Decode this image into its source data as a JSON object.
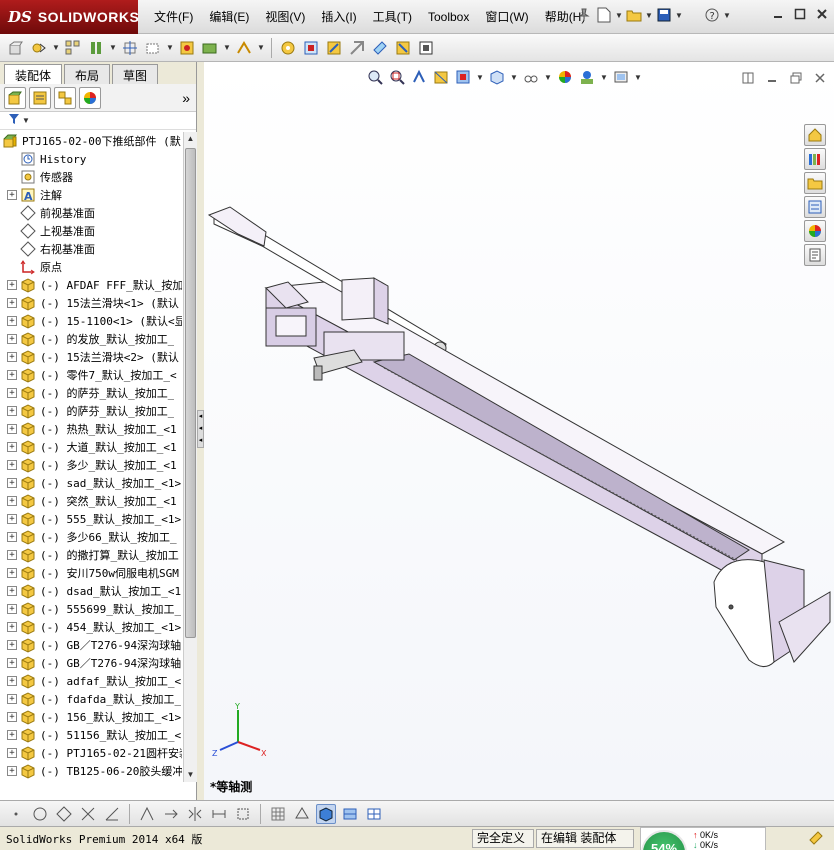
{
  "app": {
    "brand_ds": "DS",
    "brand_name": "SOLIDWORKS"
  },
  "menu": [
    "文件(F)",
    "编辑(E)",
    "视图(V)",
    "插入(I)",
    "工具(T)",
    "Toolbox",
    "窗口(W)",
    "帮助(H)"
  ],
  "title_tools": [
    "pushpin-icon",
    "new-document-icon",
    "open-folder-icon",
    "save-icon",
    "print-icon",
    "help-icon"
  ],
  "window_controls": [
    "minimize",
    "restore",
    "close"
  ],
  "toolbar_icons": [
    "insert-components-icon",
    "mate-icon",
    "linear-pattern-icon",
    "smart-fasteners-icon",
    "move-component-icon",
    "show-hidden-icon",
    "assembly-features-icon",
    "reference-geometry-icon",
    "new-motion-study-icon",
    "bill-of-materials-icon",
    "exploded-view-icon",
    "explode-line-sketch-icon",
    "interference-detection-icon",
    "clearance-verification-icon",
    "hole-alignment-icon",
    "measure-icon",
    "instant3d-icon"
  ],
  "left_panel": {
    "tabs": [
      "装配体",
      "布局",
      "草图"
    ],
    "active_tab": "装配体",
    "manager_icons": [
      "feature-manager-icon",
      "property-manager-icon",
      "configuration-manager-icon",
      "display-manager-icon"
    ],
    "more": "»",
    "filter_icon": "filter-icon",
    "tree": [
      {
        "label": "PTJ165-02-00下推纸部件  (默",
        "icon": "assembly",
        "expand": "",
        "level": 0
      },
      {
        "label": "History",
        "icon": "history",
        "expand": "",
        "level": 1
      },
      {
        "label": "传感器",
        "icon": "sensor",
        "expand": "",
        "level": 1
      },
      {
        "label": "注解",
        "icon": "annotation",
        "expand": "+",
        "level": 1
      },
      {
        "label": "前视基准面",
        "icon": "plane",
        "expand": "",
        "level": 1
      },
      {
        "label": "上视基准面",
        "icon": "plane",
        "expand": "",
        "level": 1
      },
      {
        "label": "右视基准面",
        "icon": "plane",
        "expand": "",
        "level": 1
      },
      {
        "label": "原点",
        "icon": "origin",
        "expand": "",
        "level": 1
      },
      {
        "label": "(-) AFDAF FFF_默认_按加",
        "icon": "part",
        "expand": "+",
        "level": 1
      },
      {
        "label": "(-) 15法兰滑块<1> (默认",
        "icon": "part",
        "expand": "+",
        "level": 1
      },
      {
        "label": "(-) 15-1100<1> (默认<显",
        "icon": "part",
        "expand": "+",
        "level": 1
      },
      {
        "label": "(-) 的发放_默认_按加工_",
        "icon": "part",
        "expand": "+",
        "level": 1
      },
      {
        "label": "(-) 15法兰滑块<2> (默认",
        "icon": "part",
        "expand": "+",
        "level": 1
      },
      {
        "label": "(-) 零件7_默认_按加工_<",
        "icon": "part",
        "expand": "+",
        "level": 1
      },
      {
        "label": "(-) 的萨芬_默认_按加工_",
        "icon": "part",
        "expand": "+",
        "level": 1
      },
      {
        "label": "(-) 的萨芬_默认_按加工_",
        "icon": "part",
        "expand": "+",
        "level": 1
      },
      {
        "label": "(-) 热热_默认_按加工_<1",
        "icon": "part",
        "expand": "+",
        "level": 1
      },
      {
        "label": "(-) 大道_默认_按加工_<1",
        "icon": "part",
        "expand": "+",
        "level": 1
      },
      {
        "label": "(-) 多少_默认_按加工_<1",
        "icon": "part",
        "expand": "+",
        "level": 1
      },
      {
        "label": "(-) sad_默认_按加工_<1>",
        "icon": "part",
        "expand": "+",
        "level": 1
      },
      {
        "label": "(-) 突然_默认_按加工_<1",
        "icon": "part",
        "expand": "+",
        "level": 1
      },
      {
        "label": "(-) 555_默认_按加工_<1>",
        "icon": "part",
        "expand": "+",
        "level": 1
      },
      {
        "label": "(-) 多少66_默认_按加工_",
        "icon": "part",
        "expand": "+",
        "level": 1
      },
      {
        "label": "(-) 的撒打算_默认_按加工",
        "icon": "part",
        "expand": "+",
        "level": 1
      },
      {
        "label": "(-) 安川750w伺服电机SGM",
        "icon": "part",
        "expand": "+",
        "level": 1
      },
      {
        "label": "(-) dsad_默认_按加工_<1",
        "icon": "part",
        "expand": "+",
        "level": 1
      },
      {
        "label": "(-) 555699_默认_按加工_",
        "icon": "part",
        "expand": "+",
        "level": 1
      },
      {
        "label": "(-) 454_默认_按加工_<1>",
        "icon": "part",
        "expand": "+",
        "level": 1
      },
      {
        "label": "(-) GB／T276-94深沟球轴",
        "icon": "part",
        "expand": "+",
        "level": 1
      },
      {
        "label": "(-) GB／T276-94深沟球轴",
        "icon": "part",
        "expand": "+",
        "level": 1
      },
      {
        "label": "(-) adfaf_默认_按加工_<",
        "icon": "part",
        "expand": "+",
        "level": 1
      },
      {
        "label": "(-) fdafda_默认_按加工_",
        "icon": "part",
        "expand": "+",
        "level": 1
      },
      {
        "label": "(-) 156_默认_按加工_<1>",
        "icon": "part",
        "expand": "+",
        "level": 1
      },
      {
        "label": "(-) 51156_默认_按加工_<",
        "icon": "part",
        "expand": "+",
        "level": 1
      },
      {
        "label": "(-) PTJ165-02-21圆杆安装",
        "icon": "part",
        "expand": "+",
        "level": 1
      },
      {
        "label": "(-) TB125-06-20胶头缓冲",
        "icon": "part",
        "expand": "+",
        "level": 1
      }
    ]
  },
  "viewport": {
    "view_name": "*等轴测",
    "heads_up_icons": [
      "zoom-to-fit-icon",
      "zoom-area-icon",
      "previous-view-icon",
      "section-view-icon",
      "view-orientation-icon",
      "display-style-icon",
      "hide-show-items-icon",
      "edit-appearance-icon",
      "apply-scene-icon",
      "view-settings-icon"
    ],
    "task_pane": [
      "solidworks-resources-icon",
      "design-library-icon",
      "file-explorer-icon",
      "view-palette-icon",
      "appearances-scenes-icon",
      "custom-properties-icon"
    ],
    "triad_axes": [
      "X",
      "Y",
      "Z"
    ]
  },
  "view_toolbar": [
    "point-icon",
    "circle-icon",
    "polygon-icon",
    "cross-icon",
    "angle-icon",
    "trim-icon",
    "extend-icon",
    "mirror-icon",
    "dimension-icon",
    "relation-icon",
    "grid-icon",
    "wireframe-icon",
    "shaded-edges-icon",
    "shaded-icon",
    "section-icon"
  ],
  "status": {
    "product": "SolidWorks Premium 2014 x64 版",
    "definition": "完全定义",
    "editing": "在编辑 装配体",
    "gauge_percent": "54%",
    "net_up": "0K/s",
    "net_down": "0K/s",
    "net_rate": "0K/s"
  },
  "colors": {
    "brand": "#8b1010",
    "part_icon": "#e9c400",
    "model_fill": "#e8dff0",
    "model_stroke": "#333333"
  }
}
